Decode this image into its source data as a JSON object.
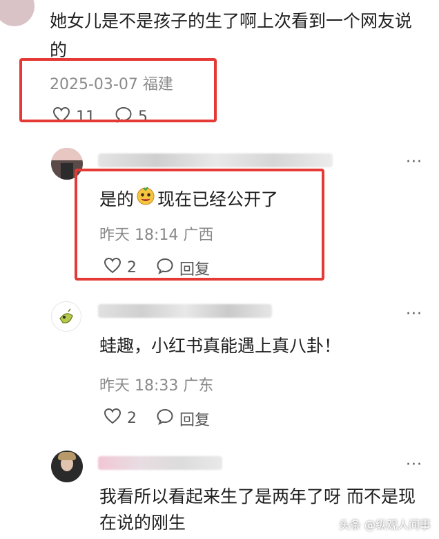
{
  "comment1": {
    "text": "她女儿是不是孩子的生了啊上次看到一个网友说的",
    "meta": "2025-03-07 福建",
    "likes": "11",
    "replies": "5"
  },
  "reply1": {
    "text_before": "是的",
    "text_after": "现在已经公开了",
    "meta": "昨天 18:14 广西",
    "likes": "2",
    "reply_label": "回复",
    "more": "···"
  },
  "reply2": {
    "text": "蛙趣，小红书真能遇上真八卦！",
    "meta": "昨天 18:33 广东",
    "likes": "2",
    "reply_label": "回复",
    "more": "···"
  },
  "reply3": {
    "text": "我看所以看起来生了是两年了呀 而不是现在说的刚生",
    "more": "···"
  },
  "watermark": "头条 @纵观人间事",
  "colors": {
    "highlight": "#e53935",
    "meta": "#8a8a8a"
  },
  "icons": [
    "heart-icon",
    "comment-bubble-icon",
    "emoji-face-icon",
    "more-icon"
  ]
}
